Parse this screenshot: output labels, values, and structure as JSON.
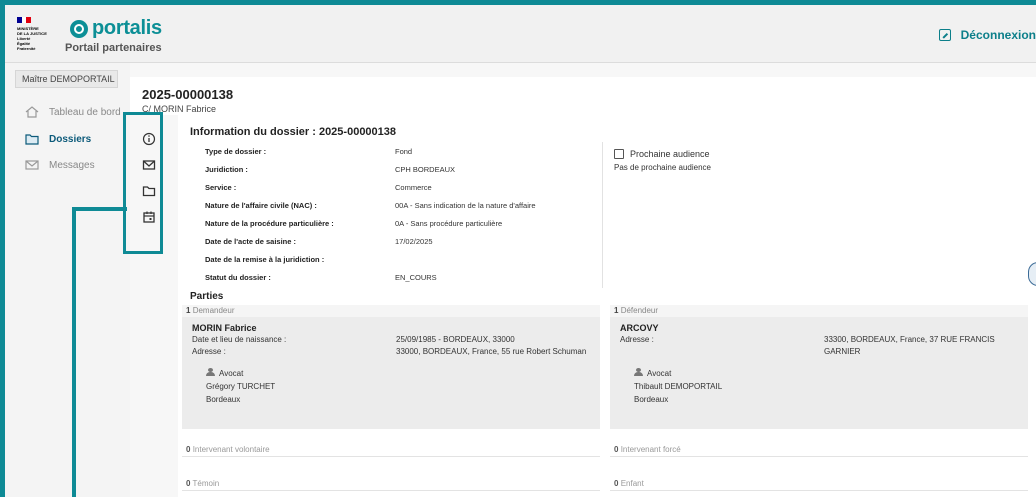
{
  "header": {
    "ministry_text": "MINISTÈRE\nDE LA JUSTICE\nLiberté\nÉgalité\nFraternité",
    "brand": "portalis",
    "subtitle": "Portail partenaires",
    "logout": "Déconnexion",
    "brand_color": "#0c8f96"
  },
  "sidebar": {
    "user": "Maître DEMOPORTAIL",
    "items": [
      {
        "label": "Tableau de bord",
        "icon": "home-icon"
      },
      {
        "label": "Dossiers",
        "icon": "folder-icon",
        "active": true
      },
      {
        "label": "Messages",
        "icon": "mail-icon"
      }
    ]
  },
  "case": {
    "id": "2025-00000138",
    "party": "C/ MORIN Fabrice"
  },
  "tools": [
    "info-icon",
    "mail-icon",
    "folder-icon",
    "calendar-icon"
  ],
  "info": {
    "title": "Information du dossier : 2025-00000138",
    "rows": [
      {
        "label": "Type de dossier :",
        "value": "Fond"
      },
      {
        "label": "Juridiction :",
        "value": "CPH BORDEAUX"
      },
      {
        "label": "Service :",
        "value": "Commerce"
      },
      {
        "label": "Nature de l'affaire civile (NAC) :",
        "value": "00A - Sans indication de la nature d'affaire"
      },
      {
        "label": "Nature de la procédure particulière :",
        "value": "0A - Sans procédure particulière"
      },
      {
        "label": "Date de l'acte de saisine :",
        "value": "17/02/2025"
      },
      {
        "label": "Date de la remise à la juridiction :",
        "value": ""
      },
      {
        "label": "Statut du dossier :",
        "value": "EN_COURS"
      }
    ],
    "next_hearing_title": "Prochaine audience",
    "next_hearing_text": "Pas de prochaine audience"
  },
  "parties": {
    "title": "Parties",
    "demandeur": {
      "count": "1",
      "role": "Demandeur",
      "name": "MORIN Fabrice",
      "birth_label": "Date et lieu de naissance :",
      "birth_value": "25/09/1985 - BORDEAUX, 33000",
      "address_label": "Adresse :",
      "address_value": "33000, BORDEAUX, France, 55 rue Robert Schuman",
      "avocat_label": "Avocat",
      "avocat_name": "Grégory TURCHET",
      "avocat_city": "Bordeaux"
    },
    "defendeur": {
      "count": "1",
      "role": "Défendeur",
      "name": "ARCOVY",
      "address_label": "Adresse :",
      "address_line1": "33300, BORDEAUX, France, 37 RUE FRANCIS",
      "address_line2": "GARNIER",
      "avocat_label": "Avocat",
      "avocat_name": "Thibault DEMOPORTAIL",
      "avocat_city": "Bordeaux"
    },
    "counters": [
      {
        "count": "0",
        "label": "Intervenant volontaire"
      },
      {
        "count": "0",
        "label": "Intervenant forcé"
      },
      {
        "count": "0",
        "label": "Témoin"
      },
      {
        "count": "0",
        "label": "Enfant"
      }
    ]
  }
}
